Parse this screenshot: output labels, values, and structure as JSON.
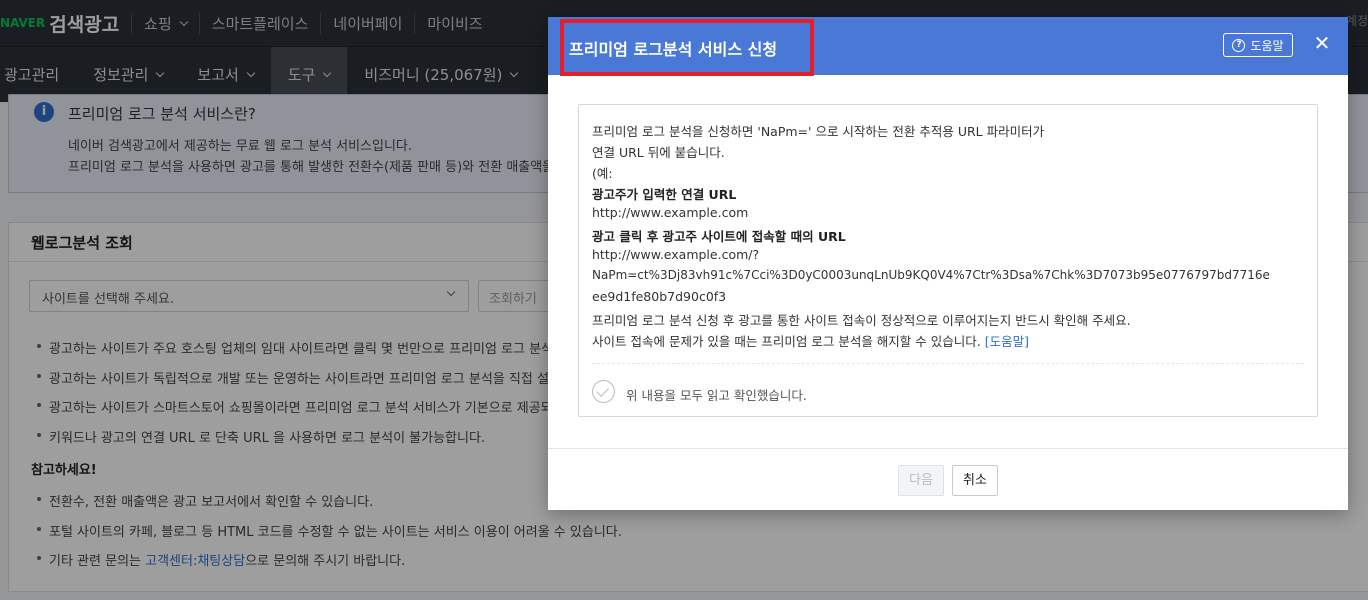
{
  "topbar": {
    "naver_logo": "NAVER",
    "app_title": "검색광고",
    "links": [
      "쇼핑",
      "스마트플레이스",
      "네이버페이",
      "마이비즈"
    ],
    "right_text": "계정"
  },
  "navbar": {
    "items": [
      {
        "label": "광고관리",
        "dropdown": false
      },
      {
        "label": "정보관리",
        "dropdown": true
      },
      {
        "label": "보고서",
        "dropdown": true
      },
      {
        "label": "도구",
        "dropdown": true,
        "active": true
      },
      {
        "label": "비즈머니 (25,067원)",
        "dropdown": true
      }
    ]
  },
  "info": {
    "icon": "i",
    "title": "프리미엄 로그 분석 서비스란?",
    "line1": "네이버 검색광고에서 제공하는 무료 웹 로그 분석 서비스입니다.",
    "line2": "프리미엄 로그 분석을 사용하면 광고를 통해 발생한 전환수(제품 판매 등)와 전환 매출액을"
  },
  "weblog": {
    "title": "웹로그분석 조회",
    "select_placeholder": "사이트를 선택해 주세요.",
    "query_button": "조회하기",
    "bullets": [
      "광고하는 사이트가 주요 호스팅 업체의 임대 사이트라면 클릭 몇 번만으로 프리미엄 로그 분석",
      "광고하는 사이트가 독립적으로 개발 또는 운영하는 사이트라면 프리미엄 로그 분석을 직접 설",
      "광고하는 사이트가 스마트스토어 쇼핑몰이라면 프리미엄 로그 분석 서비스가 기본으로 제공되",
      "키워드나 광고의 연결 URL 로 단축 URL 을 사용하면 로그 분석이 불가능합니다."
    ],
    "note_title": "참고하세요!",
    "notes": [
      "전환수, 전환 매출액은 광고 보고서에서 확인할 수 있습니다.",
      "포털 사이트의 카페, 블로그 등 HTML 코드를 수정할 수 없는 사이트는 서비스 이용이 어려울 수 있습니다."
    ],
    "last_note_prefix": "기타 관련 문의는 ",
    "last_note_link": "고객센터:채팅상담",
    "last_note_suffix": "으로 문의해 주시기 바랍니다."
  },
  "modal": {
    "title": "프리미엄 로그분석 서비스 신청",
    "help_label": "도움말",
    "close_symbol": "✕",
    "content": {
      "line1": "프리미엄 로그 분석을 신청하면 'NaPm=' 으로 시작하는 전환 추적용 URL 파라미터가",
      "line2": "연결 URL 뒤에 붙습니다.",
      "line3": "(예:",
      "line4": "광고주가 입력한 연결 URL",
      "line5": "http://www.example.com",
      "line6": "광고 클릭 후 광고주 사이트에 접속할 때의 URL",
      "line7": "http://www.example.com/?",
      "line8": "NaPm=ct%3Dj83vh91c%7Cci%3D0yC0003unqLnUb9KQ0V4%7Ctr%3Dsa%7Chk%3D7073b95e0776797bd7716e",
      "line9": "ee9d1fe80b7d90c0f3",
      "line10": "프리미엄 로그 분석 신청 후 광고를 통한 사이트 접속이 정상적으로 이루어지는지 반드시 확인해 주세요.",
      "line11": "사이트 접속에 문제가 있을 때는 프리미엄 로그 분석을 해지할 수 있습니다.",
      "line11_link": "[도움말]"
    },
    "confirm_label": "위 내용을 모두 읽고 확인했습니다.",
    "next_button": "다음",
    "cancel_button": "취소"
  },
  "colors": {
    "header_blue": "#4a78d6",
    "highlight_red": "#e61e2b",
    "naver_green": "#03c75a",
    "topbar_dark": "#2b2f36"
  }
}
